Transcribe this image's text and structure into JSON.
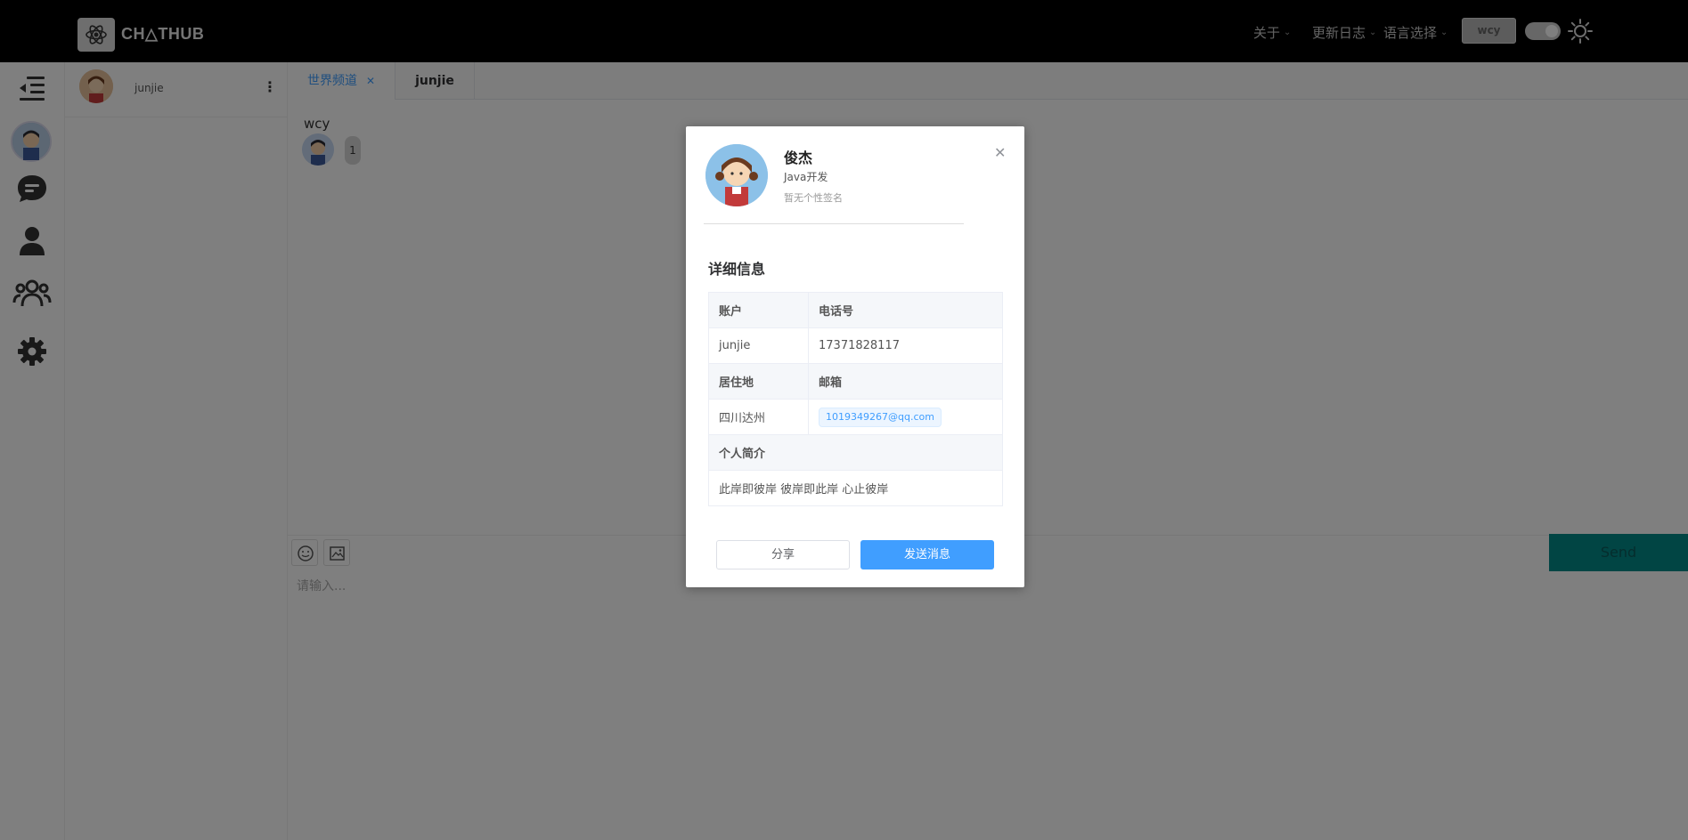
{
  "header": {
    "logo_text": "CH△THUB",
    "nav": [
      {
        "label": "关于"
      },
      {
        "label": "更新日志"
      },
      {
        "label": "语言选择"
      }
    ],
    "user_button": "wcy"
  },
  "contacts": {
    "current_user": "junjie"
  },
  "chat": {
    "tabs": [
      {
        "label": "世界频道",
        "active": true,
        "closable": true
      },
      {
        "label": "junjie",
        "active": false,
        "closable": false
      }
    ],
    "message": {
      "user": "wcy",
      "content": "1"
    },
    "input_placeholder": "请输入...",
    "send_label": "Send"
  },
  "modal": {
    "name": "俊杰",
    "title": "Java开发",
    "signature": "暂无个性签名",
    "section_title": "详细信息",
    "fields": {
      "account_label": "账户",
      "phone_label": "电话号",
      "account": "junjie",
      "phone": "17371828117",
      "residence_label": "居住地",
      "email_label": "邮箱",
      "residence": "四川达州",
      "email": "1019349267@qq.com",
      "bio_label": "个人简介",
      "bio": "此岸即彼岸 彼岸即此岸 心止彼岸"
    },
    "share_label": "分享",
    "send_message_label": "发送消息"
  },
  "colors": {
    "primary": "#409eff",
    "send_button": "#028a89",
    "header_bg": "#000000"
  }
}
